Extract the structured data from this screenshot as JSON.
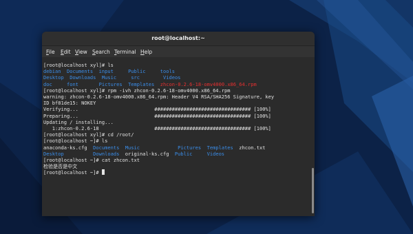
{
  "window": {
    "title": "root@localhost:~"
  },
  "menubar": {
    "items": [
      {
        "key": "F",
        "rest": "ile"
      },
      {
        "key": "E",
        "rest": "dit"
      },
      {
        "key": "V",
        "rest": "iew"
      },
      {
        "key": "S",
        "rest": "earch"
      },
      {
        "key": "T",
        "rest": "erminal"
      },
      {
        "key": "H",
        "rest": "elp"
      }
    ]
  },
  "colors": {
    "dir": "#3b8eea",
    "rpm": "#e83030",
    "text": "#e3e3e3",
    "background": "#2b2b2b"
  },
  "terminal": {
    "lines": [
      {
        "segments": [
          {
            "t": "[root@localhost xyl]# ls",
            "c": "n"
          }
        ]
      },
      {
        "segments": [
          {
            "t": "debian  ",
            "c": "d"
          },
          {
            "t": "Documents  ",
            "c": "d"
          },
          {
            "t": "input     ",
            "c": "d"
          },
          {
            "t": "Public     ",
            "c": "d"
          },
          {
            "t": "tools",
            "c": "d"
          }
        ]
      },
      {
        "segments": [
          {
            "t": "Desktop  ",
            "c": "d"
          },
          {
            "t": "Downloads  ",
            "c": "d"
          },
          {
            "t": "Music     ",
            "c": "d"
          },
          {
            "t": "src        ",
            "c": "d"
          },
          {
            "t": "Videos",
            "c": "d"
          }
        ]
      },
      {
        "segments": [
          {
            "t": "doc     ",
            "c": "d"
          },
          {
            "t": "font       ",
            "c": "d"
          },
          {
            "t": "Pictures  ",
            "c": "d"
          },
          {
            "t": "Templates  ",
            "c": "d"
          },
          {
            "t": "zhcon-0.2.6-18-omv4000.x86_64.rpm",
            "c": "r"
          }
        ]
      },
      {
        "segments": [
          {
            "t": "[root@localhost xyl]# rpm -ivh zhcon-0.2.6-18-omv4000.x86_64.rpm",
            "c": "n"
          }
        ]
      },
      {
        "segments": [
          {
            "t": "warning: zhcon-0.2.6-18-omv4000.x86_64.rpm: Header V4 RSA/SHA256 Signature, key",
            "c": "n"
          }
        ]
      },
      {
        "segments": [
          {
            "t": "ID bf81de15: NOKEY",
            "c": "n"
          }
        ]
      },
      {
        "segments": [
          {
            "t": "Verifying...                          ################################# [100%]",
            "c": "n"
          }
        ]
      },
      {
        "segments": [
          {
            "t": "Preparing...                          ################################# [100%]",
            "c": "n"
          }
        ]
      },
      {
        "segments": [
          {
            "t": "Updating / installing...",
            "c": "n"
          }
        ]
      },
      {
        "segments": [
          {
            "t": "   1:zhcon-0.2.6-18                   ################################# [100%]",
            "c": "n"
          }
        ]
      },
      {
        "segments": [
          {
            "t": "[root@localhost xyl]# cd /root/",
            "c": "n"
          }
        ]
      },
      {
        "segments": [
          {
            "t": "[root@localhost ~]# ls",
            "c": "n"
          }
        ]
      },
      {
        "segments": [
          {
            "t": "anaconda-ks.cfg  ",
            "c": "n"
          },
          {
            "t": "Documents  ",
            "c": "d"
          },
          {
            "t": "Music             ",
            "c": "d"
          },
          {
            "t": "Pictures  ",
            "c": "d"
          },
          {
            "t": "Templates  ",
            "c": "d"
          },
          {
            "t": "zhcon.txt",
            "c": "n"
          }
        ]
      },
      {
        "segments": [
          {
            "t": "Desktop          ",
            "c": "d"
          },
          {
            "t": "Downloads  ",
            "c": "d"
          },
          {
            "t": "original-ks.cfg  ",
            "c": "n"
          },
          {
            "t": "Public     ",
            "c": "d"
          },
          {
            "t": "Videos",
            "c": "d"
          }
        ]
      },
      {
        "segments": [
          {
            "t": "[root@localhost ~]# cat zhcon.txt",
            "c": "n"
          }
        ]
      },
      {
        "segments": [
          {
            "t": "检验是否是中文",
            "c": "n"
          }
        ]
      },
      {
        "segments": [
          {
            "t": "[root@localhost ~]# ",
            "c": "n"
          }
        ],
        "cursor": true
      }
    ]
  }
}
